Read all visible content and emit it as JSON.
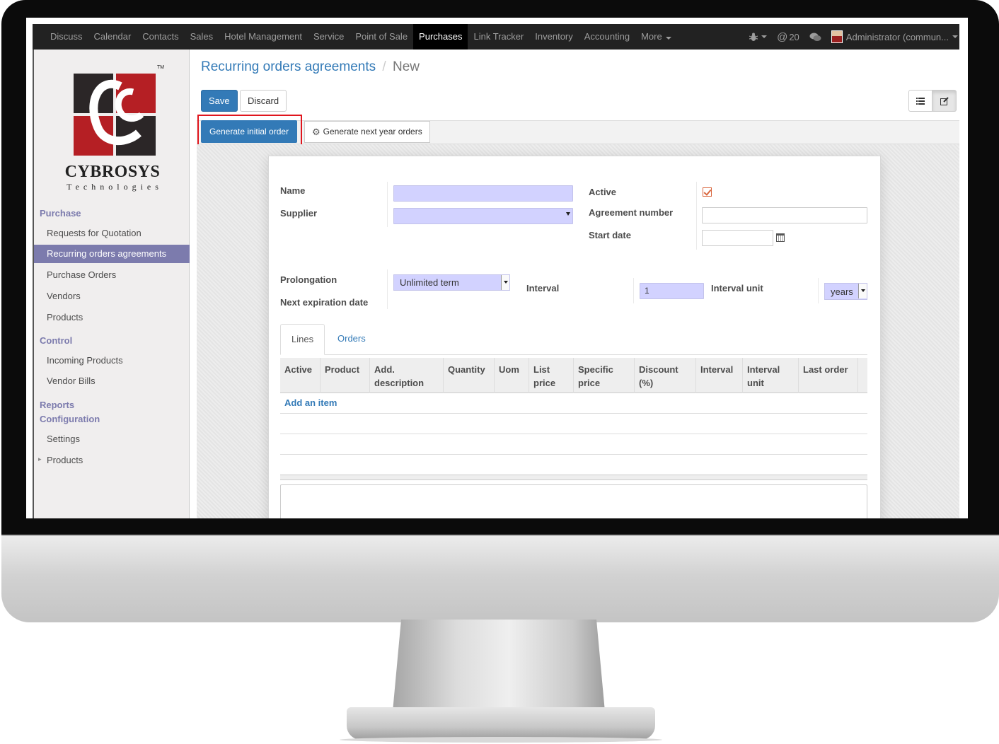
{
  "navbar": {
    "menu": [
      "Discuss",
      "Calendar",
      "Contacts",
      "Sales",
      "Hotel Management",
      "Service",
      "Point of Sale",
      "Purchases",
      "Link Tracker",
      "Inventory",
      "Accounting",
      "More"
    ],
    "active": "Purchases",
    "message_count": "20",
    "user_label": "Administrator (commun..."
  },
  "sidebar": {
    "brand_name": "CYBROSYS",
    "brand_sub": "Technologies",
    "brand_tm": "TM",
    "sections": {
      "purchase": "Purchase",
      "control": "Control",
      "reports": "Reports",
      "configuration": "Configuration"
    },
    "purchase_items": [
      "Requests for Quotation",
      "Recurring orders agreements",
      "Purchase Orders",
      "Vendors",
      "Products"
    ],
    "control_items": [
      "Incoming Products",
      "Vendor Bills"
    ],
    "configuration_items": [
      "Settings",
      "Products"
    ],
    "active_item": "Recurring orders agreements"
  },
  "breadcrumb": {
    "parent": "Recurring orders agreements",
    "separator": "/",
    "current": "New"
  },
  "buttons": {
    "save": "Save",
    "discard": "Discard",
    "generate_initial": "Generate initial order",
    "generate_next": "Generate next year orders"
  },
  "form": {
    "labels": {
      "name": "Name",
      "supplier": "Supplier",
      "active": "Active",
      "agreement_number": "Agreement number",
      "start_date": "Start date",
      "prolongation": "Prolongation",
      "next_expiration_date": "Next expiration date",
      "interval": "Interval",
      "interval_unit": "Interval unit"
    },
    "values": {
      "name": "",
      "supplier": "",
      "active": true,
      "agreement_number": "",
      "start_date": "",
      "prolongation": "Unlimited term",
      "interval": "1",
      "interval_unit": "years"
    }
  },
  "tabs": [
    "Lines",
    "Orders"
  ],
  "active_tab": "Lines",
  "lines_table": {
    "columns": [
      "Active",
      "Product",
      "Add. description",
      "Quantity",
      "Uom",
      "List price",
      "Specific price",
      "Discount (%)",
      "Interval",
      "Interval unit",
      "Last order"
    ],
    "add_item": "Add an item"
  },
  "colors": {
    "primary": "#337ab7",
    "sidebar_active": "#7c7bad",
    "required_field": "#d2d2ff",
    "highlight_box": "#e0151d",
    "navbar": "#222222"
  }
}
